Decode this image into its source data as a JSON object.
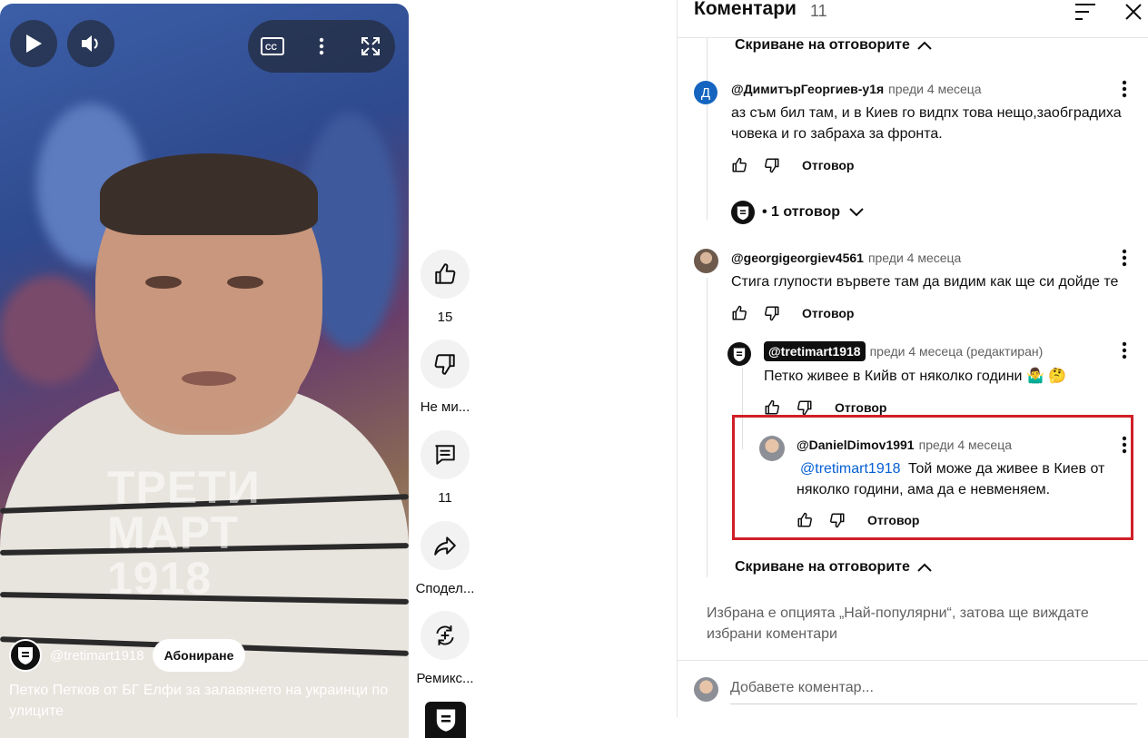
{
  "video": {
    "watermark": [
      "ТРЕТИ",
      "МАРТ",
      "1918"
    ],
    "channel": "@tretimart1918",
    "subscribe_label": "Абониране",
    "title": "Петко Петков от БГ Елфи за залавянето на украинци по улиците"
  },
  "actions": {
    "like_count": "15",
    "dislike_label": "Не ми...",
    "comments_count": "11",
    "share_label": "Сподел...",
    "remix_label": "Ремикс..."
  },
  "comments_panel": {
    "title": "Коментари",
    "count": "11",
    "hide_replies_label": "Скриване на отговорите",
    "reply_label": "Отговор",
    "comments": [
      {
        "avatar_letter": "Д",
        "author": "@ДимитърГеоргиев-у1я",
        "time": "преди 4 месеца",
        "text": "аз съм бил там, и в Киев го видпх това нещо,заобградиха човека  и го забраха за фронта.",
        "replies_summary": "• 1 отговор"
      },
      {
        "author": "@georgigeorgiev4561",
        "time": "преди 4 месеца",
        "text": "Стига глупости вървете там да видим как ще си дойде те",
        "replies": [
          {
            "author": "@tretimart1918",
            "time": "преди 4 месеца (редактиран)",
            "text": "Петко живее в Кийв от няколко години 🤷‍♂️ 🤔"
          },
          {
            "author": "@DanielDimov1991",
            "time": "преди 4 месеца",
            "mention": "@tretimart1918",
            "text": "Той може да живее в Киев от няколко години, ама да е невменяем."
          }
        ]
      }
    ],
    "sort_note": "Избрана е опцията „Най-популярни“, затова ще виждате избрани коментари",
    "add_comment_placeholder": "Добавете коментар..."
  },
  "colors": {
    "highlight_border": "#d01f27",
    "mention": "#065fd4",
    "letter_avatar": "#1565c0"
  }
}
